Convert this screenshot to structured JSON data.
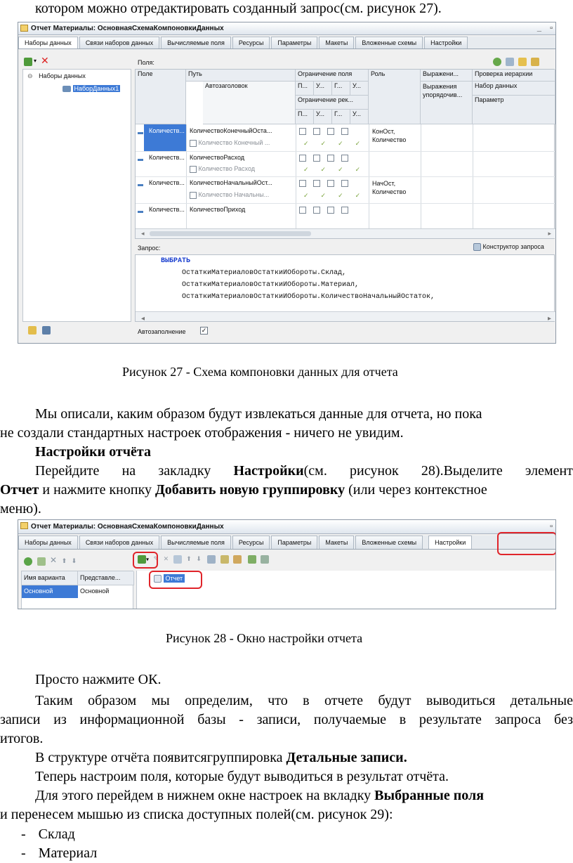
{
  "doc": {
    "top_line": "котором можно отредактировать созданный запрос(см. рисунок 27).",
    "fig27_caption": "Рисунок 27 - Схема компоновки данных для отчета",
    "para1_l1": "Мы описали, каким образом будут извлекаться данные для отчета, но пока",
    "para1_l2": "не создали стандартных настроек отображения - ничего не увидим.",
    "heading": "Настройки отчёта",
    "para2_l1a": "Перейдите",
    "para2_l1b": "на",
    "para2_l1c": "закладку",
    "para2_l1d": "Настройки",
    "para2_l1e": "(см.",
    "para2_l1f": "рисунок",
    "para2_l1g": "28).Выделите",
    "para2_l1h": "элемент",
    "para2_l2a": "Отчет",
    "para2_l2b": " и нажмите кнопку ",
    "para2_l2c": "Добавить новую группировку",
    "para2_l2d": " (или через контекстное",
    "para2_l3": "меню).",
    "fig28_caption": "Рисунок 28 - Окно настройки отчета",
    "para3": "Просто нажмите ОК.",
    "para4_l1": "Таким образом мы определим, что в отчете будут выводиться детальные",
    "para4_l2": "записи из информационной базы - записи, получаемые в результате запроса без",
    "para4_l3": "итогов.",
    "para5a": "В структуре отчёта появитсягруппировка ",
    "para5b": "Детальные записи.",
    "para6": "Теперь настроим поля, которые будут выводиться в результат отчёта.",
    "para7_l1a": "Для этого перейдем в нижнем окне настроек на вкладку ",
    "para7_l1b": "Выбранные поля",
    "para7_l2": "и перенесем мышью из списка доступных полей(см. рисунок 29):",
    "list": [
      {
        "dash": "-",
        "text": "Склад"
      },
      {
        "dash": "-",
        "text": "Материал"
      }
    ]
  },
  "fig27": {
    "title": "Отчет Материалы: ОсновнаяСхемаКомпоновкиДанных",
    "tabs": [
      "Наборы данных",
      "Связи наборов данных",
      "Вычисляемые поля",
      "Ресурсы",
      "Параметры",
      "Макеты",
      "Вложенные схемы",
      "Настройки"
    ],
    "fields_label": "Поля:",
    "tree_root": "Наборы данных",
    "tree_child": "НаборДанных1",
    "headers": {
      "field": "Поле",
      "path": "Путь",
      "autotitle": "Автозаголовок",
      "restriction": "Ограничение поля",
      "restriction_req": "Ограничение рек...",
      "sub": [
        "П...",
        "У...",
        "Г...",
        "У..."
      ],
      "role": "Роль",
      "expr": "Выражени...",
      "expr_sort": "Выражения упорядочив...",
      "hier": "Проверка иерархии",
      "hier_set": "Набор данных",
      "hier_param": "Параметр"
    },
    "rows": [
      {
        "field": "Количеств...",
        "path": "КоличествоКонечныйОста...",
        "title": "Количество Конечный ...",
        "role": "КонОст, Количество"
      },
      {
        "field": "Количеств...",
        "path": "КоличествоРасход",
        "title": "Количество Расход",
        "role": ""
      },
      {
        "field": "Количеств...",
        "path": "КоличествоНачальныйОст...",
        "title": "Количество Начальны...",
        "role": "НачОст, Количество"
      },
      {
        "field": "Количеств...",
        "path": "КоличествоПриход",
        "title": "",
        "role": ""
      }
    ],
    "query_label": "Запрос:",
    "constructor": "Конструктор запроса",
    "query_lines": [
      "ВЫБРАТЬ",
      "ОстаткиМатериаловОстаткиИОбороты.Склад,",
      "ОстаткиМатериаловОстаткиИОбороты.Материал,",
      "ОстаткиМатериаловОстаткиИОбороты.КоличествоНачальныйОстаток,"
    ],
    "autofill": "Автозаполнение"
  },
  "fig28": {
    "title": "Отчет Материалы: ОсновнаяСхемаКомпоновкиДанных",
    "tabs": [
      "Наборы данных",
      "Связи наборов данных",
      "Вычисляемые поля",
      "Ресурсы",
      "Параметры",
      "Макеты",
      "Вложенные схемы",
      "Настройки"
    ],
    "col_variant": "Имя варианта",
    "col_repr": "Представле...",
    "variant_name": "Основной",
    "variant_repr": "Основной",
    "tree_item": "Отчет"
  },
  "colors": {
    "selection": "#3d7ad6",
    "highlight": "#e0242a",
    "keyword": "#1a3fcf"
  }
}
